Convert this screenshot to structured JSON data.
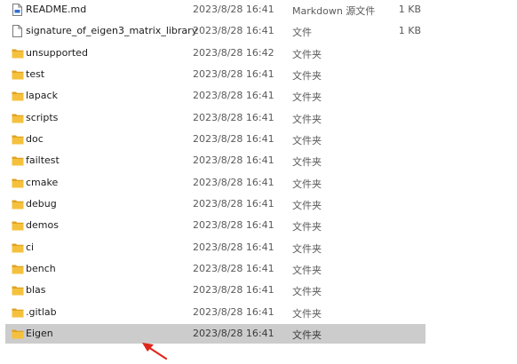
{
  "files": [
    {
      "name": "README.md",
      "date": "2023/8/28 16:41",
      "type": "Markdown 源文件",
      "size": "1 KB",
      "icon": "markdown-file-icon",
      "selected": false
    },
    {
      "name": "signature_of_eigen3_matrix_library",
      "date": "2023/8/28 16:41",
      "type": "文件",
      "size": "1 KB",
      "icon": "file-icon",
      "selected": false
    },
    {
      "name": "unsupported",
      "date": "2023/8/28 16:42",
      "type": "文件夹",
      "size": "",
      "icon": "folder-icon",
      "selected": false
    },
    {
      "name": "test",
      "date": "2023/8/28 16:41",
      "type": "文件夹",
      "size": "",
      "icon": "folder-icon",
      "selected": false
    },
    {
      "name": "lapack",
      "date": "2023/8/28 16:41",
      "type": "文件夹",
      "size": "",
      "icon": "folder-icon",
      "selected": false
    },
    {
      "name": "scripts",
      "date": "2023/8/28 16:41",
      "type": "文件夹",
      "size": "",
      "icon": "folder-icon",
      "selected": false
    },
    {
      "name": "doc",
      "date": "2023/8/28 16:41",
      "type": "文件夹",
      "size": "",
      "icon": "folder-icon",
      "selected": false
    },
    {
      "name": "failtest",
      "date": "2023/8/28 16:41",
      "type": "文件夹",
      "size": "",
      "icon": "folder-icon",
      "selected": false
    },
    {
      "name": "cmake",
      "date": "2023/8/28 16:41",
      "type": "文件夹",
      "size": "",
      "icon": "folder-icon",
      "selected": false
    },
    {
      "name": "debug",
      "date": "2023/8/28 16:41",
      "type": "文件夹",
      "size": "",
      "icon": "folder-icon",
      "selected": false
    },
    {
      "name": "demos",
      "date": "2023/8/28 16:41",
      "type": "文件夹",
      "size": "",
      "icon": "folder-icon",
      "selected": false
    },
    {
      "name": "ci",
      "date": "2023/8/28 16:41",
      "type": "文件夹",
      "size": "",
      "icon": "folder-icon",
      "selected": false
    },
    {
      "name": "bench",
      "date": "2023/8/28 16:41",
      "type": "文件夹",
      "size": "",
      "icon": "folder-icon",
      "selected": false
    },
    {
      "name": "blas",
      "date": "2023/8/28 16:41",
      "type": "文件夹",
      "size": "",
      "icon": "folder-icon",
      "selected": false
    },
    {
      "name": ".gitlab",
      "date": "2023/8/28 16:41",
      "type": "文件夹",
      "size": "",
      "icon": "folder-icon",
      "selected": false
    },
    {
      "name": "Eigen",
      "date": "2023/8/28 16:41",
      "type": "文件夹",
      "size": "",
      "icon": "folder-icon",
      "selected": true
    }
  ],
  "colors": {
    "folder": "#f5c13d",
    "folder_dark": "#e0a21f",
    "selection": "#cccccc",
    "annotation_arrow": "#e0261b"
  }
}
